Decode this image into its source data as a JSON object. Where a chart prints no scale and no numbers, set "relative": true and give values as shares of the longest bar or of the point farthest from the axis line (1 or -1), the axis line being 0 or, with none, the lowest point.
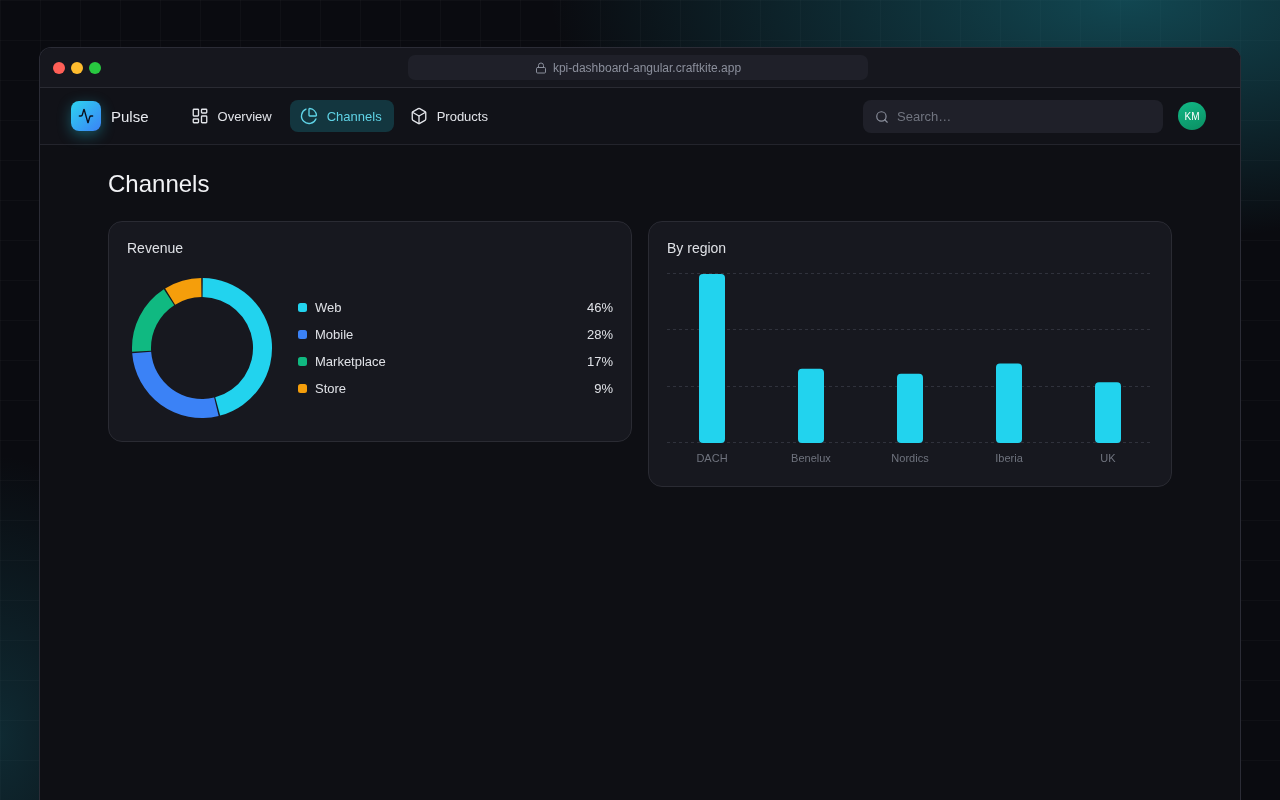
{
  "browser": {
    "url": "kpi-dashboard-angular.craftkite.app"
  },
  "header": {
    "brand": "Pulse",
    "nav": [
      {
        "label": "Overview",
        "selected": false
      },
      {
        "label": "Channels",
        "selected": true
      },
      {
        "label": "Products",
        "selected": false
      }
    ],
    "search": {
      "placeholder": "Search…"
    },
    "avatar": "KM"
  },
  "page_title": "Channels",
  "revenue_card": {
    "title": "Revenue",
    "chart_data": {
      "type": "donut",
      "categories": [
        "Web",
        "Mobile",
        "Marketplace",
        "Store"
      ],
      "values": [
        46,
        28,
        17,
        9
      ]
    },
    "legend": [
      {
        "share": "46%",
        "color": "#22d3ee"
      },
      {
        "share": "28%",
        "color": "#3b82f6"
      },
      {
        "share": "17%",
        "color": "#10b981"
      },
      {
        "share": "9%",
        "color": "#f59e0b"
      }
    ]
  },
  "region_card": {
    "title": "By region",
    "chart_data": {
      "type": "bar",
      "relative": true,
      "categories": [
        "DACH",
        "Benelux",
        "Nordics",
        "Iberia",
        "UK"
      ],
      "series": [
        {
          "color": "#22d3ee",
          "values": [
            1,
            0.44,
            0.41,
            0.47,
            0.36
          ]
        }
      ]
    }
  }
}
